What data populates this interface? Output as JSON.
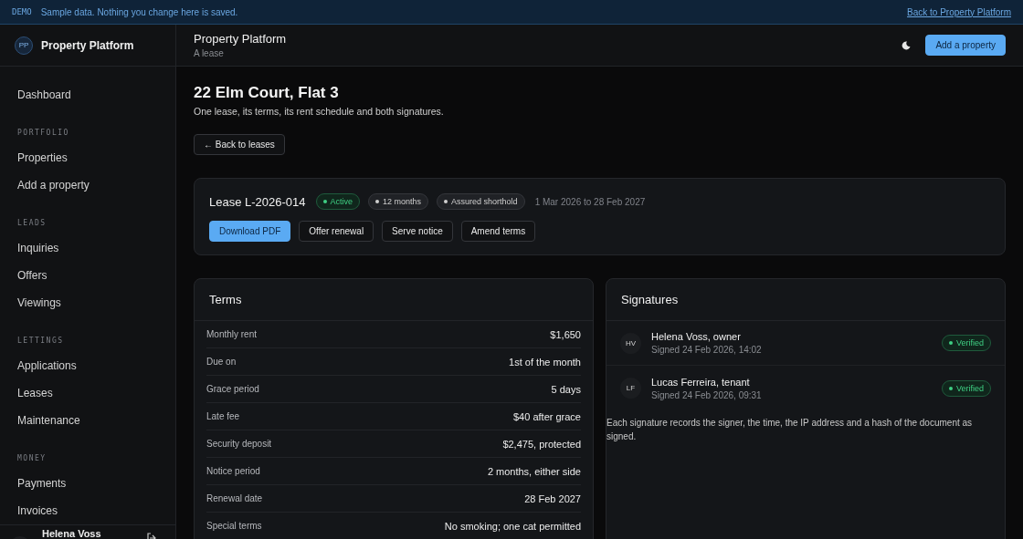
{
  "banner": {
    "tag": "DEMO",
    "message": "Sample data. Nothing you change here is saved.",
    "link": "Back to Property Platform"
  },
  "sidebar": {
    "brand": {
      "initials": "PP",
      "name": "Property Platform"
    },
    "sections": [
      {
        "items": [
          "Dashboard"
        ]
      },
      {
        "heading": "PORTFOLIO",
        "items": [
          "Properties",
          "Add a property"
        ]
      },
      {
        "heading": "LEADS",
        "items": [
          "Inquiries",
          "Offers",
          "Viewings"
        ]
      },
      {
        "heading": "LETTINGS",
        "items": [
          "Applications",
          "Leases",
          "Maintenance"
        ]
      },
      {
        "heading": "MONEY",
        "items": [
          "Payments",
          "Invoices"
        ]
      }
    ],
    "user": {
      "name": "Helena Voss"
    }
  },
  "header": {
    "title": "Property Platform",
    "subtitle": "A lease",
    "action": "Add a property"
  },
  "page": {
    "title": "22 Elm Court, Flat 3",
    "description": "One lease, its terms, its rent schedule and both signatures.",
    "back": "← Back to leases"
  },
  "lease": {
    "title": "Lease L-2026-014",
    "badges": [
      {
        "label": "Active",
        "kind": "success"
      },
      {
        "label": "12 months",
        "kind": "neutral"
      },
      {
        "label": "Assured shorthold",
        "kind": "neutral"
      }
    ],
    "dates": "1 Mar 2026 to 28 Feb 2027",
    "actions": [
      {
        "label": "Download PDF",
        "kind": "primary"
      },
      {
        "label": "Offer renewal",
        "kind": "secondary"
      },
      {
        "label": "Serve notice",
        "kind": "secondary"
      },
      {
        "label": "Amend terms",
        "kind": "secondary"
      }
    ]
  },
  "terms": {
    "title": "Terms",
    "rows": [
      {
        "label": "Monthly rent",
        "value": "$1,650"
      },
      {
        "label": "Due on",
        "value": "1st of the month"
      },
      {
        "label": "Grace period",
        "value": "5 days"
      },
      {
        "label": "Late fee",
        "value": "$40 after grace"
      },
      {
        "label": "Security deposit",
        "value": "$2,475, protected"
      },
      {
        "label": "Notice period",
        "value": "2 months, either side"
      },
      {
        "label": "Renewal date",
        "value": "28 Feb 2027"
      },
      {
        "label": "Special terms",
        "value": "No smoking; one cat permitted"
      }
    ]
  },
  "signatures": {
    "title": "Signatures",
    "items": [
      {
        "initials": "HV",
        "name": "Helena Voss, owner",
        "signed": "Signed 24 Feb 2026, 14:02",
        "status": "Verified",
        "kind": "success"
      },
      {
        "initials": "LF",
        "name": "Lucas Ferreira, tenant",
        "signed": "Signed 24 Feb 2026, 09:31",
        "status": "Verified",
        "kind": "success"
      }
    ],
    "note": "Each signature records the signer, the time, the IP address and a hash of the document as signed."
  }
}
